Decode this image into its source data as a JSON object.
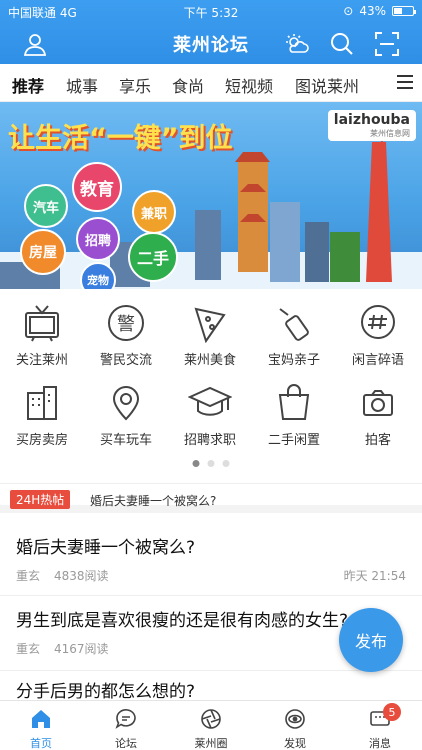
{
  "status": {
    "carrier": "中国联通 4G",
    "time": "下午 5:32",
    "battery": "43%",
    "battery_level": 0.43
  },
  "nav": {
    "title": "莱州论坛"
  },
  "tabs": [
    {
      "label": "推荐"
    },
    {
      "label": "城事"
    },
    {
      "label": "享乐"
    },
    {
      "label": "食尚"
    },
    {
      "label": "短视频"
    },
    {
      "label": "图说莱州"
    }
  ],
  "banner": {
    "slogan": "让生活“一键”到位",
    "logo": "laizhouba",
    "logo_sub": "莱州信息网",
    "bubbles": [
      "教育",
      "汽车",
      "兼职",
      "房屋",
      "招聘",
      "二手",
      "宠物"
    ]
  },
  "grid": [
    {
      "label": "关注莱州",
      "icon": "tv-icon"
    },
    {
      "label": "警民交流",
      "icon": "police-icon"
    },
    {
      "label": "莱州美食",
      "icon": "pizza-icon"
    },
    {
      "label": "宝妈亲子",
      "icon": "bottle-icon"
    },
    {
      "label": "闲言碎语",
      "icon": "chat-hash-icon"
    },
    {
      "label": "买房卖房",
      "icon": "building-icon"
    },
    {
      "label": "买车玩车",
      "icon": "location-icon"
    },
    {
      "label": "招聘求职",
      "icon": "graduation-cap-icon"
    },
    {
      "label": "二手闲置",
      "icon": "shopping-bag-icon"
    },
    {
      "label": "拍客",
      "icon": "camera-icon"
    }
  ],
  "hot": {
    "tag": "24H热帖",
    "text": "婚后夫妻睡一个被窝么?"
  },
  "posts": [
    {
      "title": "婚后夫妻睡一个被窝么?",
      "author": "重玄",
      "reads": "4838阅读",
      "date": "昨天 21:54"
    },
    {
      "title": "男生到底是喜欢很瘦的还是很有肉感的女生?",
      "author": "重玄",
      "reads": "4167阅读",
      "date": ""
    },
    {
      "title": "分手后男的都怎么想的?",
      "author": "",
      "reads": "",
      "date": ""
    }
  ],
  "publish": "发布",
  "bottom_nav": [
    {
      "label": "首页"
    },
    {
      "label": "论坛"
    },
    {
      "label": "莱州圈"
    },
    {
      "label": "发现"
    },
    {
      "label": "消息",
      "badge": "5"
    }
  ],
  "colors": {
    "primary": "#2f8fe6",
    "badge": "#e84c3d"
  }
}
